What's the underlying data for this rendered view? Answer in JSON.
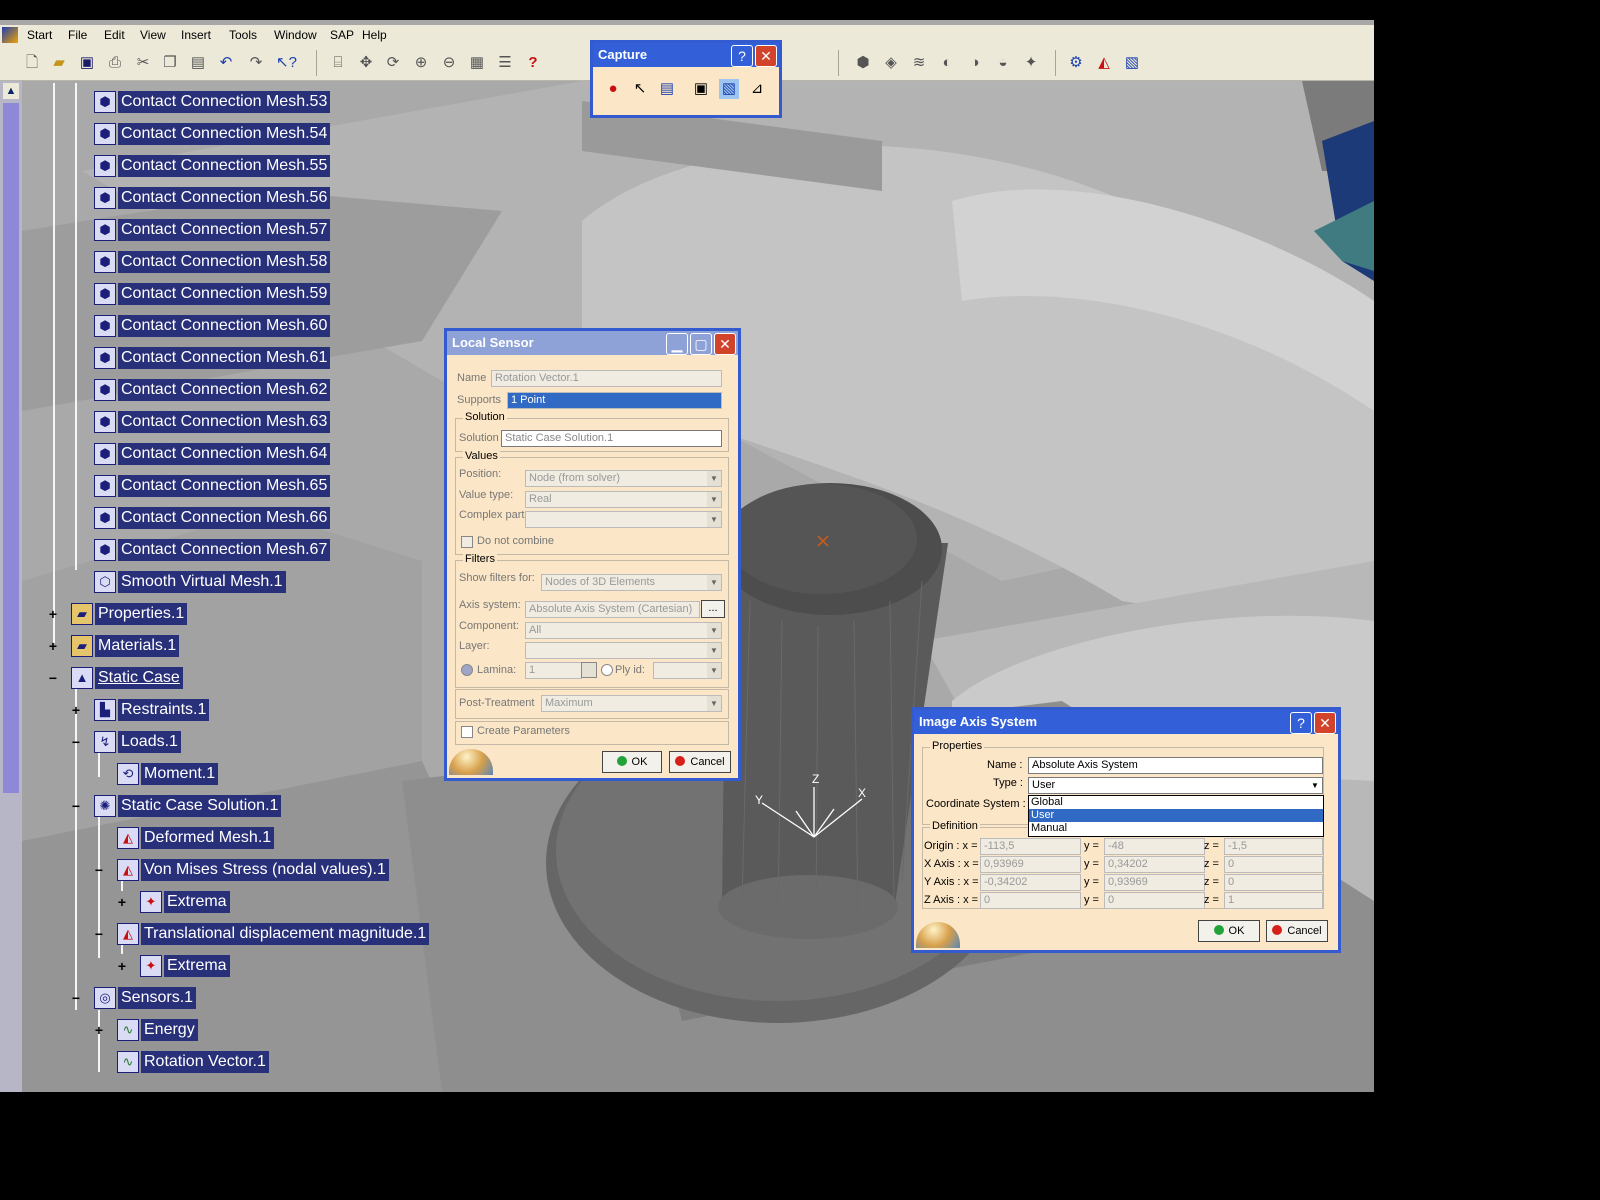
{
  "menubar": {
    "items": [
      "Start",
      "File",
      "Edit",
      "View",
      "Insert",
      "Tools",
      "Window",
      "SAP",
      "Help"
    ]
  },
  "toolbar": {
    "left_icons": [
      "new-icon",
      "open-icon",
      "save-icon",
      "print-icon",
      "cut-icon",
      "copy-icon",
      "paste-icon",
      "undo-icon",
      "redo-icon",
      "whats-this-icon",
      "fly-mode-icon",
      "pan-icon",
      "rotate-icon",
      "zoom-in-icon",
      "zoom-out-icon",
      "normal-view-icon",
      "hide-show-icon",
      "swap-icon",
      "help-icon"
    ],
    "right_icons": [
      "mesh-icon",
      "sensor-icon",
      "deform-icon",
      "animate-icon",
      "cut-plane-icon",
      "amplification-icon",
      "extrema-icon",
      "compute-icon",
      "report-icon",
      "image-layout-icon"
    ]
  },
  "capture": {
    "title": "Capture",
    "help_label": "?",
    "close_label": "✕",
    "buttons": [
      "record-icon",
      "select-icon",
      "options-icon",
      "capture-mode-icon",
      "image-icon",
      "measure-icon"
    ]
  },
  "tree": {
    "mesh_items": [
      "Contact Connection Mesh.53",
      "Contact Connection Mesh.54",
      "Contact Connection Mesh.55",
      "Contact Connection Mesh.56",
      "Contact Connection Mesh.57",
      "Contact Connection Mesh.58",
      "Contact Connection Mesh.59",
      "Contact Connection Mesh.60",
      "Contact Connection Mesh.61",
      "Contact Connection Mesh.62",
      "Contact Connection Mesh.63",
      "Contact Connection Mesh.64",
      "Contact Connection Mesh.65",
      "Contact Connection Mesh.66",
      "Contact Connection Mesh.67"
    ],
    "smooth_mesh": "Smooth Virtual Mesh.1",
    "properties": "Properties.1",
    "materials": "Materials.1",
    "static_case": "Static Case",
    "restraints": "Restraints.1",
    "loads": "Loads.1",
    "moment": "Moment.1",
    "solution": "Static Case Solution.1",
    "deformed": "Deformed Mesh.1",
    "von_mises": "Von Mises Stress (nodal values).1",
    "extrema_1": "Extrema",
    "translational": "Translational displacement magnitude.1",
    "extrema_2": "Extrema",
    "sensors": "Sensors.1",
    "energy": "Energy",
    "rotation": "Rotation Vector.1",
    "expander_plus": "+",
    "expander_minus": "−"
  },
  "local_sensor": {
    "title": "Local Sensor",
    "name_label": "Name",
    "name_value": "Rotation Vector.1",
    "supports_label": "Supports",
    "supports_value": "1 Point",
    "solution_legend": "Solution",
    "solution_label": "Solution",
    "solution_value": "Static Case Solution.1",
    "values_legend": "Values",
    "position_label": "Position:",
    "position_value": "Node (from solver)",
    "value_type_label": "Value type:",
    "value_type_value": "Real",
    "complex_label": "Complex part:",
    "complex_value": "",
    "do_not_combine": "Do not combine",
    "filters_legend": "Filters",
    "show_filters_label": "Show filters for:",
    "show_filters_value": "Nodes of 3D Elements",
    "axis_label": "Axis system:",
    "axis_value": "Absolute Axis System (Cartesian)",
    "axis_more": "...",
    "component_label": "Component:",
    "component_value": "All",
    "layer_label": "Layer:",
    "layer_value": "",
    "lamina_label": "Lamina:",
    "lamina_value": "1",
    "ply_label": "Ply id:",
    "ply_value": "",
    "post_label": "Post-Treatment",
    "post_value": "Maximum",
    "create_params": "Create Parameters",
    "ok": "OK",
    "cancel": "Cancel"
  },
  "image_axis": {
    "title": "Image Axis System",
    "help_label": "?",
    "close_label": "✕",
    "properties_legend": "Properties",
    "name_label": "Name :",
    "name_value": "Absolute Axis System",
    "type_label": "Type :",
    "type_value": "User",
    "coord_label": "Coordinate System :",
    "options": [
      "Global",
      "User",
      "Manual"
    ],
    "definition_legend": "Definition",
    "rows": [
      {
        "label": "Origin : x =",
        "x": "-113,5",
        "y": "-48",
        "z": "-1,5"
      },
      {
        "label": "X Axis : x =",
        "x": "0,93969",
        "y": "0,34202",
        "z": "0"
      },
      {
        "label": "Y Axis : x =",
        "x": "-0,34202",
        "y": "0,93969",
        "z": "0"
      },
      {
        "label": "Z Axis : x =",
        "x": "0",
        "y": "0",
        "z": "1"
      }
    ],
    "y_label": "y =",
    "z_label": "z =",
    "ok": "OK",
    "cancel": "Cancel"
  },
  "axis_triad": {
    "x": "X",
    "y": "Y",
    "z": "Z"
  },
  "colors": {
    "tree_label_bg": "#29307a",
    "title_bar": "#3360d8",
    "dialog_bg": "#fbe6c7",
    "selection": "#316ac5"
  }
}
